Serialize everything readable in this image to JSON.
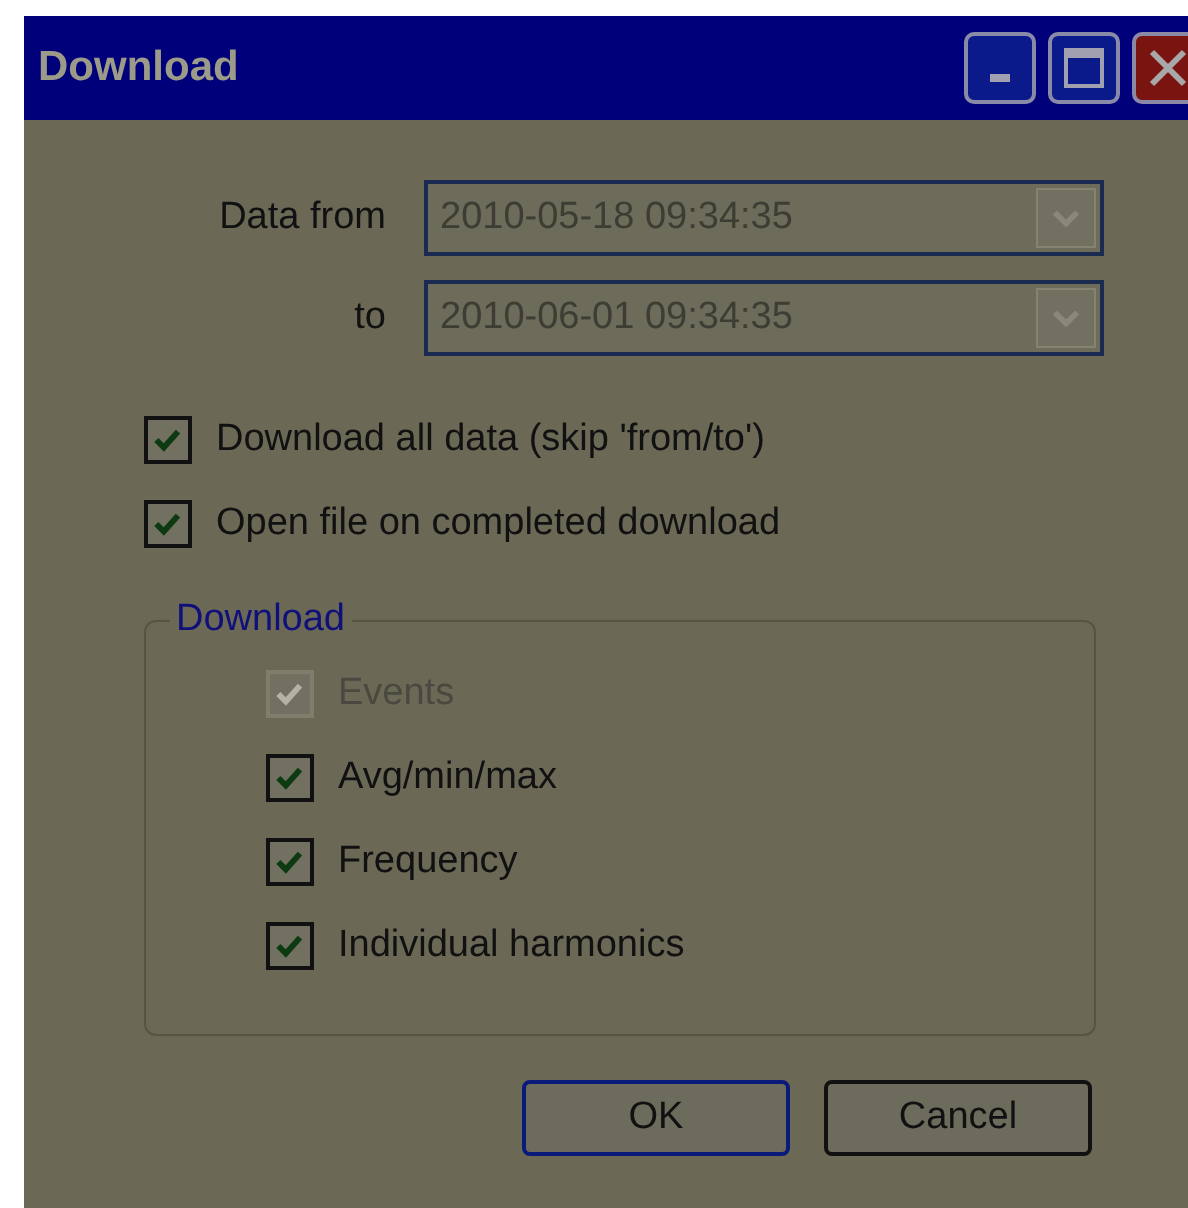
{
  "window": {
    "title": "Download"
  },
  "fields": [
    {
      "label": "Data from",
      "value": "2010-05-18 09:34:35",
      "disabled": true
    },
    {
      "label": "to",
      "value": "2010-06-01 09:34:35",
      "disabled": true
    }
  ],
  "options": [
    {
      "label": "Download all data (skip 'from/to')",
      "checked": true,
      "disabled": false
    },
    {
      "label": "Open file on completed download",
      "checked": true,
      "disabled": false
    }
  ],
  "group": {
    "title": "Download",
    "items": [
      {
        "label": "Events",
        "checked": true,
        "disabled": true
      },
      {
        "label": "Avg/min/max",
        "checked": true,
        "disabled": false
      },
      {
        "label": "Frequency",
        "checked": true,
        "disabled": false
      },
      {
        "label": "Individual harmonics",
        "checked": true,
        "disabled": false
      }
    ]
  },
  "buttons": [
    {
      "label": "OK",
      "default": true
    },
    {
      "label": "Cancel",
      "default": false
    }
  ]
}
